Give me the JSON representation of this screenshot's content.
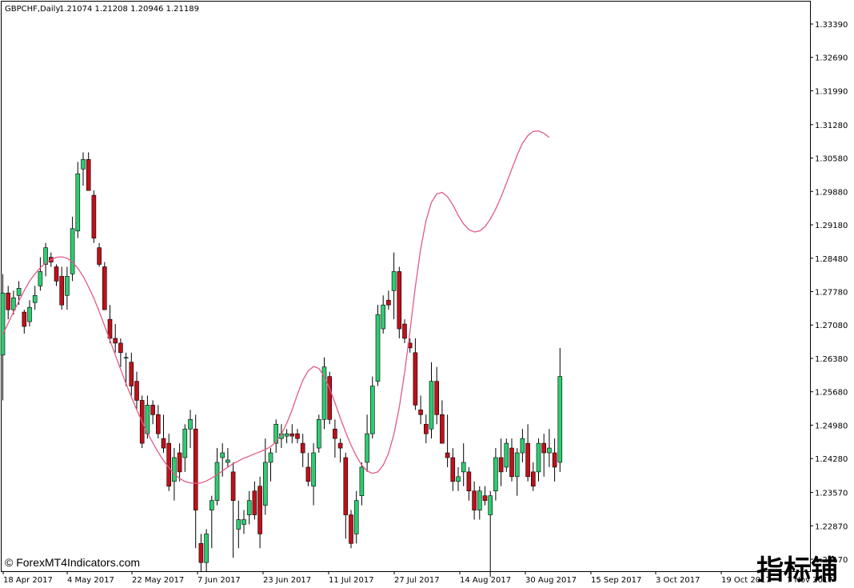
{
  "header": {
    "symbol_timeframe": "GBPCHF,Daily",
    "ohlc": "1.21074 1.21208 1.20946 1.21189"
  },
  "copyright": "© ForexMT4Indicators.com",
  "watermark": "指标铺",
  "colors": {
    "bull": "#2ecc71",
    "bear": "#c0101a",
    "wick": "#000000",
    "ma_line": "#e05a86",
    "frame": "#000000",
    "background": "#ffffff"
  },
  "chart_data": {
    "type": "candlestick",
    "symbol": "GBPCHF",
    "timeframe": "Daily",
    "y_axis_ticks": [
      "1.33390",
      "1.32690",
      "1.31990",
      "1.31280",
      "1.30580",
      "1.29880",
      "1.29180",
      "1.28480",
      "1.27780",
      "1.27080",
      "1.26380",
      "1.25680",
      "1.24980",
      "1.24280",
      "1.23570",
      "1.22870",
      "1.22170"
    ],
    "ylim": [
      1.2182,
      1.3381
    ],
    "x_axis_ticks": [
      "18 Apr 2017",
      "4 May 2017",
      "22 May 2017",
      "7 Jun 2017",
      "23 Jun 2017",
      "11 Jul 2017",
      "27 Jul 2017",
      "14 Aug 2017",
      "30 Aug 2017",
      "15 Sep 2017",
      "3 Oct 2017",
      "19 Oct 2017",
      "7 Nov 2017"
    ],
    "grid": false,
    "ma_line": {
      "color": "#e05a86",
      "values": [
        1.2688,
        1.2712,
        1.2735,
        1.2758,
        1.278,
        1.28,
        1.2815,
        1.2828,
        1.2838,
        1.2845,
        1.285,
        1.2851,
        1.2848,
        1.284,
        1.2827,
        1.281,
        1.2788,
        1.2764,
        1.2736,
        1.2706,
        1.2676,
        1.2645,
        1.2615,
        1.2585,
        1.2557,
        1.253,
        1.2505,
        1.2482,
        1.2461,
        1.2441,
        1.2424,
        1.2409,
        1.2396,
        1.2386,
        1.238,
        1.2377,
        1.2376,
        1.2377,
        1.2381,
        1.2387,
        1.2394,
        1.2402,
        1.241,
        1.2417,
        1.2423,
        1.2429,
        1.2433,
        1.2438,
        1.2442,
        1.2447,
        1.2453,
        1.2463,
        1.2479,
        1.2502,
        1.253,
        1.2563,
        1.2592,
        1.2612,
        1.2621,
        1.2617,
        1.26,
        1.2575,
        1.2545,
        1.2513,
        1.2483,
        1.2456,
        1.2433,
        1.2414,
        1.2402,
        1.2397,
        1.24,
        1.2414,
        1.2439,
        1.2479,
        1.2535,
        1.2608,
        1.2695,
        1.2788,
        1.2868,
        1.2927,
        1.2965,
        1.2983,
        1.2986,
        1.2977,
        1.296,
        1.2938,
        1.292,
        1.2908,
        1.2903,
        1.2905,
        1.2914,
        1.293,
        1.2951,
        1.2976,
        1.3005,
        1.3035,
        1.3064,
        1.3089,
        1.3105,
        1.3114,
        1.3115,
        1.311,
        1.3101
      ]
    },
    "candles": [
      [
        1.2645,
        1.2815,
        1.255,
        1.2775
      ],
      [
        1.2775,
        1.279,
        1.272,
        1.274
      ],
      [
        1.274,
        1.278,
        1.273,
        1.2765
      ],
      [
        1.277,
        1.28,
        1.275,
        1.2785
      ],
      [
        1.2735,
        1.274,
        1.269,
        1.2705
      ],
      [
        1.2715,
        1.276,
        1.2705,
        1.2745
      ],
      [
        1.2755,
        1.279,
        1.274,
        1.277
      ],
      [
        1.279,
        1.285,
        1.278,
        1.282
      ],
      [
        1.2835,
        1.288,
        1.281,
        1.287
      ],
      [
        1.285,
        1.286,
        1.283,
        1.284
      ],
      [
        1.283,
        1.2835,
        1.279,
        1.28
      ],
      [
        1.281,
        1.283,
        1.274,
        1.275
      ],
      [
        1.277,
        1.283,
        1.274,
        1.281
      ],
      [
        1.2815,
        1.2935,
        1.28,
        1.291
      ],
      [
        1.2905,
        1.305,
        1.289,
        1.3025
      ],
      [
        1.3035,
        1.307,
        1.3,
        1.3055
      ],
      [
        1.3055,
        1.307,
        1.299,
        1.299
      ],
      [
        1.298,
        1.299,
        1.288,
        1.289
      ],
      [
        1.287,
        1.288,
        1.283,
        1.2835
      ],
      [
        1.283,
        1.284,
        1.274,
        1.274
      ],
      [
        1.272,
        1.275,
        1.267,
        1.268
      ],
      [
        1.268,
        1.271,
        1.265,
        1.267
      ],
      [
        1.267,
        1.268,
        1.262,
        1.265
      ],
      [
        1.264,
        1.265,
        1.258,
        1.264
      ],
      [
        1.263,
        1.265,
        1.256,
        1.258
      ],
      [
        1.259,
        1.261,
        1.253,
        1.255
      ],
      [
        1.255,
        1.256,
        1.245,
        1.246
      ],
      [
        1.248,
        1.256,
        1.247,
        1.254
      ],
      [
        1.254,
        1.255,
        1.25,
        1.252
      ],
      [
        1.252,
        1.254,
        1.247,
        1.248
      ],
      [
        1.247,
        1.252,
        1.244,
        1.245
      ],
      [
        1.246,
        1.248,
        1.236,
        1.237
      ],
      [
        1.238,
        1.245,
        1.234,
        1.243
      ],
      [
        1.244,
        1.246,
        1.238,
        1.24
      ],
      [
        1.243,
        1.25,
        1.24,
        1.249
      ],
      [
        1.249,
        1.253,
        1.245,
        1.251
      ],
      [
        1.249,
        1.252,
        1.224,
        1.232
      ],
      [
        1.225,
        1.227,
        1.219,
        1.221
      ],
      [
        1.221,
        1.228,
        1.219,
        1.227
      ],
      [
        1.232,
        1.235,
        1.224,
        1.234
      ],
      [
        1.234,
        1.245,
        1.233,
        1.242
      ],
      [
        1.243,
        1.246,
        1.239,
        1.244
      ],
      [
        1.242,
        1.245,
        1.241,
        1.2425
      ],
      [
        1.24,
        1.242,
        1.222,
        1.234
      ],
      [
        1.228,
        1.234,
        1.224,
        1.23
      ],
      [
        1.229,
        1.232,
        1.227,
        1.23
      ],
      [
        1.231,
        1.236,
        1.229,
        1.234
      ],
      [
        1.236,
        1.238,
        1.23,
        1.231
      ],
      [
        1.237,
        1.239,
        1.224,
        1.227
      ],
      [
        1.233,
        1.247,
        1.231,
        1.242
      ],
      [
        1.242,
        1.245,
        1.238,
        1.244
      ],
      [
        1.246,
        1.251,
        1.244,
        1.25
      ],
      [
        1.247,
        1.25,
        1.245,
        1.248
      ],
      [
        1.2475,
        1.249,
        1.246,
        1.248
      ],
      [
        1.248,
        1.25,
        1.246,
        1.2475
      ],
      [
        1.248,
        1.249,
        1.246,
        1.247
      ],
      [
        1.246,
        1.248,
        1.241,
        1.244
      ],
      [
        1.241,
        1.244,
        1.237,
        1.238
      ],
      [
        1.237,
        1.246,
        1.233,
        1.244
      ],
      [
        1.245,
        1.252,
        1.244,
        1.251
      ],
      [
        1.251,
        1.264,
        1.249,
        1.262
      ],
      [
        1.26,
        1.261,
        1.25,
        1.251
      ],
      [
        1.249,
        1.251,
        1.243,
        1.247
      ],
      [
        1.246,
        1.247,
        1.242,
        1.245
      ],
      [
        1.243,
        1.244,
        1.226,
        1.231
      ],
      [
        1.231,
        1.232,
        1.224,
        1.225
      ],
      [
        1.227,
        1.236,
        1.225,
        1.234
      ],
      [
        1.235,
        1.242,
        1.233,
        1.241
      ],
      [
        1.242,
        1.252,
        1.24,
        1.248
      ],
      [
        1.248,
        1.26,
        1.247,
        1.258
      ],
      [
        1.259,
        1.275,
        1.258,
        1.273
      ],
      [
        1.27,
        1.277,
        1.269,
        1.275
      ],
      [
        1.276,
        1.278,
        1.274,
        1.275
      ],
      [
        1.278,
        1.286,
        1.272,
        1.282
      ],
      [
        1.282,
        1.283,
        1.268,
        1.27
      ],
      [
        1.271,
        1.272,
        1.267,
        1.268
      ],
      [
        1.267,
        1.268,
        1.265,
        1.266
      ],
      [
        1.265,
        1.268,
        1.253,
        1.254
      ],
      [
        1.253,
        1.256,
        1.25,
        1.252
      ],
      [
        1.25,
        1.252,
        1.246,
        1.248
      ],
      [
        1.249,
        1.263,
        1.247,
        1.259
      ],
      [
        1.259,
        1.262,
        1.25,
        1.252
      ],
      [
        1.252,
        1.255,
        1.246,
        1.246
      ],
      [
        1.244,
        1.252,
        1.241,
        1.243
      ],
      [
        1.243,
        1.245,
        1.236,
        1.238
      ],
      [
        1.238,
        1.241,
        1.236,
        1.239
      ],
      [
        1.24,
        1.246,
        1.237,
        1.242
      ],
      [
        1.24,
        1.241,
        1.234,
        1.236
      ],
      [
        1.236,
        1.238,
        1.23,
        1.232
      ],
      [
        1.232,
        1.237,
        1.23,
        1.236
      ],
      [
        1.235,
        1.237,
        1.233,
        1.234
      ],
      [
        1.231,
        1.236,
        1.218,
        1.235
      ],
      [
        1.236,
        1.245,
        1.234,
        1.243
      ],
      [
        1.243,
        1.247,
        1.237,
        1.24
      ],
      [
        1.241,
        1.247,
        1.24,
        1.246
      ],
      [
        1.245,
        1.247,
        1.238,
        1.239
      ],
      [
        1.239,
        1.245,
        1.235,
        1.244
      ],
      [
        1.244,
        1.249,
        1.242,
        1.247
      ],
      [
        1.246,
        1.25,
        1.238,
        1.239
      ],
      [
        1.24,
        1.242,
        1.236,
        1.237
      ],
      [
        1.24,
        1.247,
        1.238,
        1.246
      ],
      [
        1.246,
        1.248,
        1.239,
        1.244
      ],
      [
        1.244,
        1.249,
        1.241,
        1.245
      ],
      [
        1.244,
        1.247,
        1.238,
        1.241
      ],
      [
        1.242,
        1.266,
        1.24,
        1.26
      ]
    ]
  }
}
